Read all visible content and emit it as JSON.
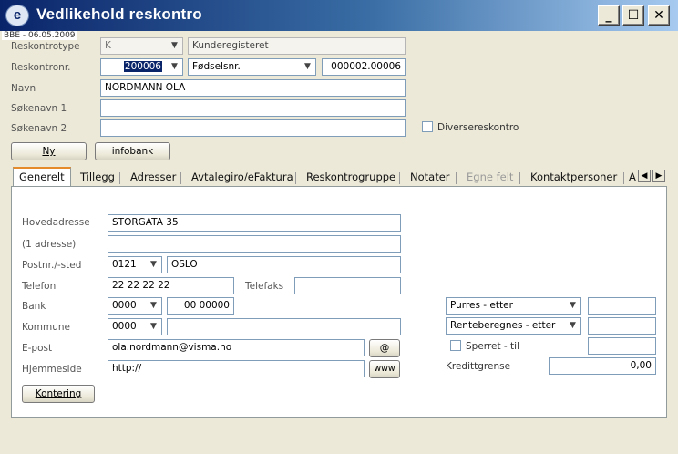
{
  "window": {
    "title": "Vedlikehold reskontro",
    "icon_text": "e",
    "minimize": "_",
    "maximize": "☐",
    "close": "✕"
  },
  "stamp": "BBE - 06.05.2009",
  "header": {
    "reskontrotype_label": "Reskontrotype",
    "reskontrotype_value": "K",
    "kunderegister": "Kunderegisteret",
    "reskontronr_label": "Reskontronr.",
    "reskontronr_value": "200006",
    "fodselsnr_select": "Fødselsnr.",
    "fodselsnr_value": "000002.00006",
    "navn_label": "Navn",
    "navn_value": "NORDMANN OLA",
    "sokenavn1_label": "Søkenavn 1",
    "sokenavn1_value": "",
    "sokenavn2_label": "Søkenavn 2",
    "sokenavn2_value": "",
    "diverse_label": "Diversereskontro",
    "ny_button": "Ny",
    "infobank_button": "infobank"
  },
  "tabs": [
    "Generelt",
    "Tillegg",
    "Adresser",
    "Avtalegiro/eFaktura",
    "Reskontrogruppe",
    "Notater",
    "Egne felt",
    "Kontaktpersoner",
    "A"
  ],
  "tab_scroll": {
    "left": "◀",
    "right": "▶"
  },
  "general": {
    "hovedadresse_label": "Hovedadresse",
    "hovedadresse_value": "STORGATA 35",
    "adresse1_label": "(1 adresse)",
    "adresse1_value": "",
    "postnr_label": "Postnr./-sted",
    "postnr_value": "0121",
    "poststed_value": "OSLO",
    "telefon_label": "Telefon",
    "telefon_value": "22 22 22 22",
    "telefaks_label": "Telefaks",
    "telefaks_value": "",
    "bank_label": "Bank",
    "bank_value": "0000",
    "bank_konto": "00 00000",
    "kommune_label": "Kommune",
    "kommune_value": "0000",
    "kommune_name": "",
    "epost_label": "E-post",
    "epost_value": "ola.nordmann@visma.no",
    "at_button": "@",
    "hjemmeside_label": "Hjemmeside",
    "hjemmeside_value": "http://",
    "www_button": "www",
    "kontering_button": "Kontering",
    "purres_select": "Purres - etter",
    "purres_value": "",
    "rente_select": "Renteberegnes - etter",
    "rente_value": "",
    "sperret_label": "Sperret  -  til",
    "sperret_value": "",
    "kreditt_label": "Kredittgrense",
    "kreditt_value": "0,00"
  }
}
